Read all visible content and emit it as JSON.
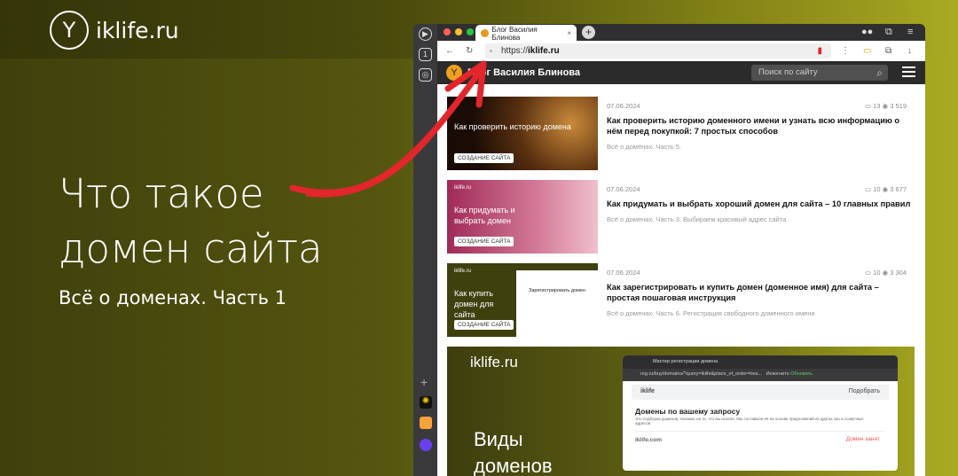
{
  "brand": {
    "name": "iklife.ru"
  },
  "headline": {
    "line1": "Что такое",
    "line2": "домен сайта",
    "subtitle": "Всё о доменах. Часть 1"
  },
  "browser": {
    "tab_title": "Блог Василия Блинова",
    "url_prefix": "https://",
    "url_domain": "iklife.ru",
    "colors": {
      "accent": "#e2262b"
    }
  },
  "site": {
    "title": "Блог Василия Блинова",
    "search_placeholder": "Поиск по сайту",
    "articles": [
      {
        "date": "07.06.2024",
        "comments": "13",
        "views": "3 519",
        "title": "Как проверить историю доменного имени и узнать всю информацию о нём перед покупкой: 7 простых способов",
        "desc": "Всё о доменах. Часть 5.",
        "thumb_text": "Как проверить историю домена",
        "thumb_button": "СОЗДАНИЕ САЙТА"
      },
      {
        "date": "07.06.2024",
        "comments": "10",
        "views": "3 677",
        "title": "Как придумать и выбрать хороший домен для сайта – 10 главных правил",
        "desc": "Всё о доменах. Часть 3. Выбираем красивый адрес сайта",
        "thumb_text": "Как придумать и выбрать домен",
        "thumb_button": "СОЗДАНИЕ САЙТА",
        "thumb_brand": "iklife.ru"
      },
      {
        "date": "07.06.2024",
        "comments": "10",
        "views": "3 304",
        "title": "Как зарегистрировать и купить домен (доменное имя) для сайта – простая пошаговая инструкция",
        "desc": "Всё о доменах. Часть 6. Регистрация свободного доменного имени",
        "thumb_text": "Как купить домен для сайта",
        "thumb_button": "СОЗДАНИЕ САЙТА",
        "thumb_brand": "iklife.ru",
        "thumb_inner": "Зарегистрировать домен"
      }
    ],
    "banner": {
      "brand": "iklife.ru",
      "title1": "Виды",
      "title2": "доменов",
      "mini_tab": "Мастер регистрации домена",
      "mini_url": "reg.ru/buy/domains/?query=iklife&place_of_order=hea...",
      "mini_incognito": "Инкогнито",
      "mini_update": "Обновить",
      "mini_query": "iklife",
      "mini_button": "Подобрать",
      "mini_heading": "Домены по вашему запросу",
      "mini_text": "Это подборка доменов, похожих на те, что вы искали. Мы составили её на основе предложений из других зон и созвучных адресов.",
      "mini_domain": "iklife.com",
      "mini_status": "Домен занят"
    }
  }
}
